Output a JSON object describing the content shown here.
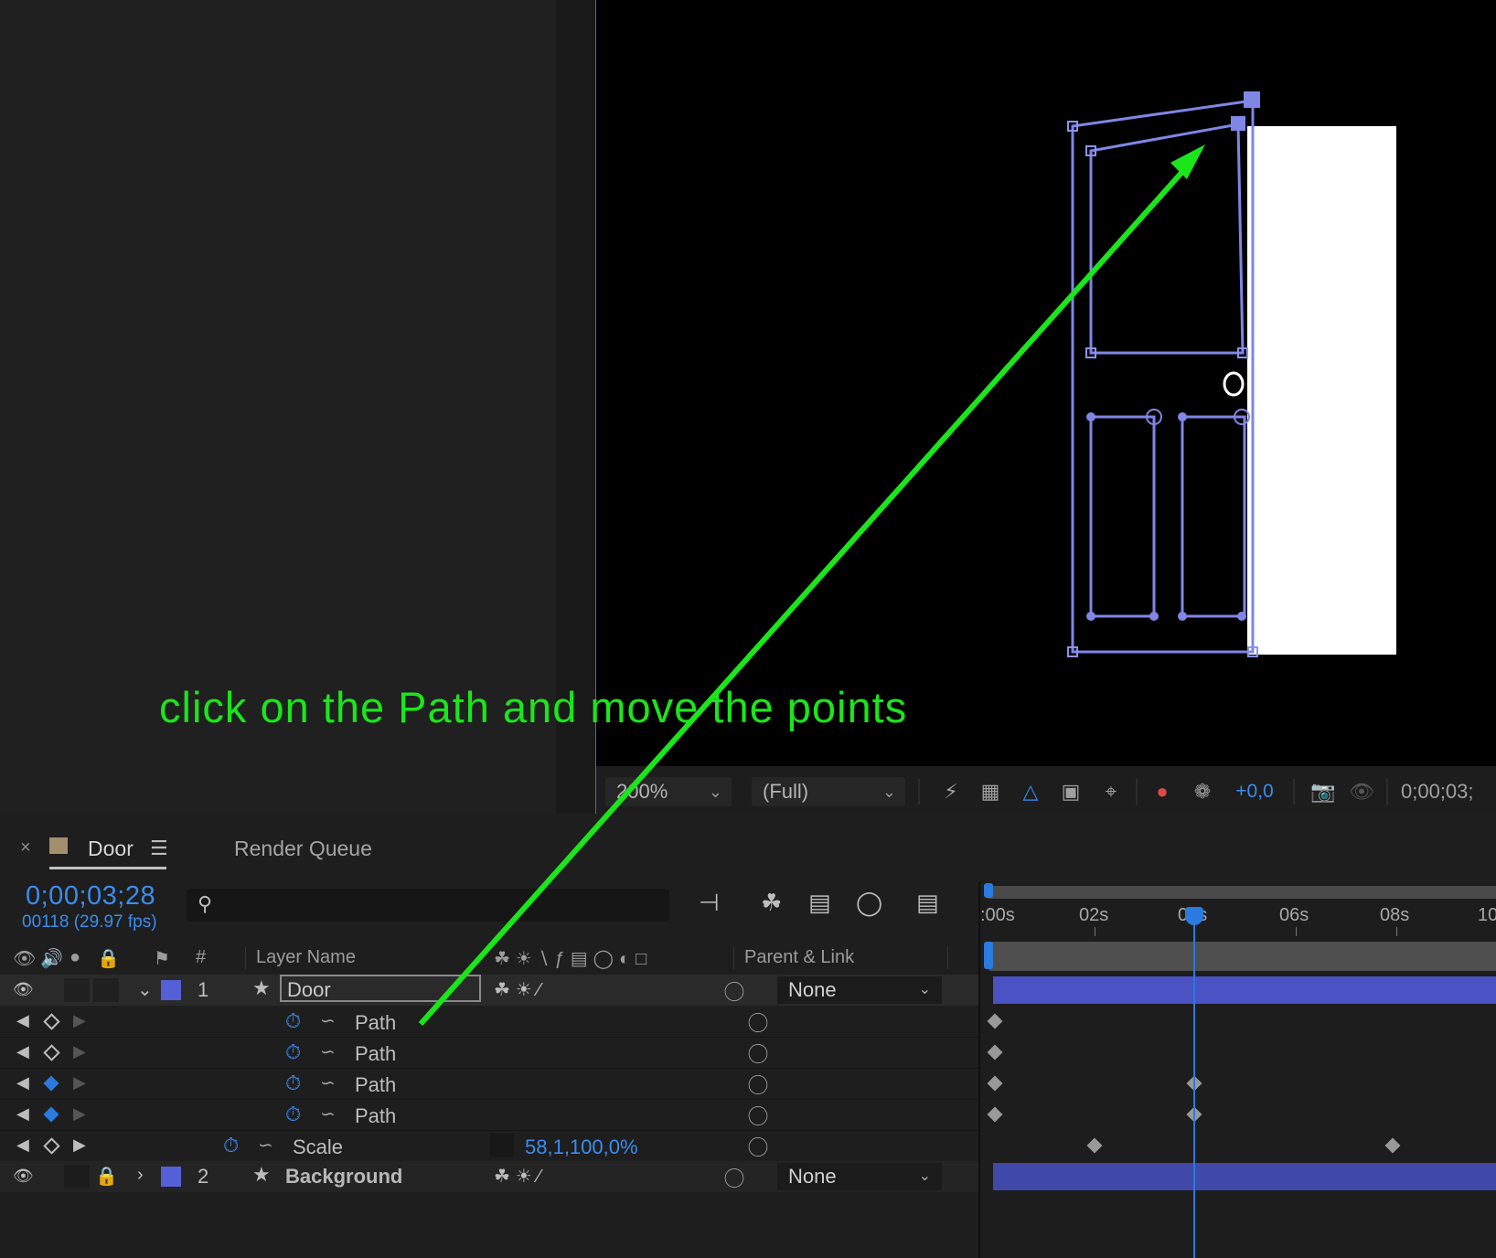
{
  "annotation": {
    "text": "click on the Path and move the points",
    "color": "#1be51b"
  },
  "viewer": {
    "zoom": "200%",
    "resolution": "(Full)",
    "exposure": "+0,0",
    "timecode": "0;00;03;"
  },
  "timeline": {
    "tabs": [
      {
        "label": "Door",
        "active": true
      },
      {
        "label": "Render Queue",
        "active": false
      }
    ],
    "current_time": "0;00;03;28",
    "frame_info": "00118 (29.97 fps)",
    "search_placeholder": "",
    "headers": {
      "number": "#",
      "layer_name": "Layer Name",
      "parent_link": "Parent & Link"
    },
    "ruler_labels": [
      ":00s",
      "02s",
      "04s",
      "06s",
      "08s",
      "10"
    ],
    "layers": [
      {
        "num": "1",
        "name": "Door",
        "parent": "None",
        "expanded": true,
        "color": "#5560d8"
      },
      {
        "num": "2",
        "name": "Background",
        "parent": "None",
        "expanded": false,
        "color": "#5560d8"
      }
    ],
    "properties": [
      {
        "name": "Path",
        "keyframe_at_current": false
      },
      {
        "name": "Path",
        "keyframe_at_current": false
      },
      {
        "name": "Path",
        "keyframe_at_current": true
      },
      {
        "name": "Path",
        "keyframe_at_current": true
      },
      {
        "name": "Scale",
        "value": "58,1,100,0%",
        "keyframe_at_current": false
      }
    ]
  },
  "colors": {
    "accent_blue": "#3a8df0",
    "layer_bar": "#4a52c4",
    "panel_border": "#3d66d9"
  }
}
